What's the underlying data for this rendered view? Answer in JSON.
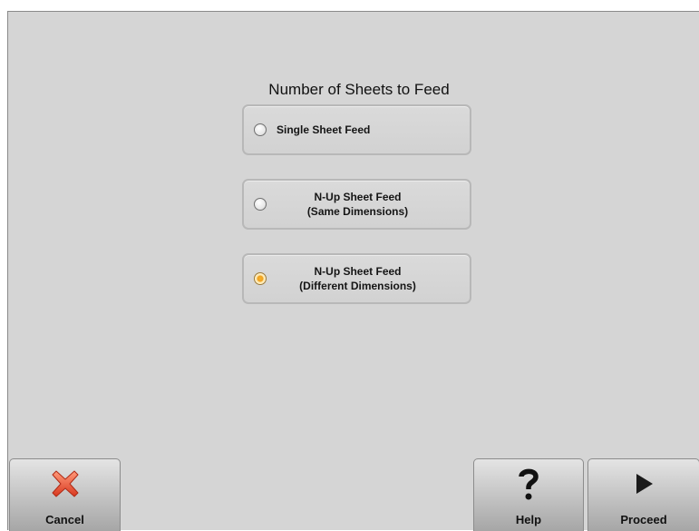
{
  "dialog": {
    "heading": "Number of Sheets to Feed",
    "options": [
      {
        "line1": "Single Sheet Feed",
        "line2": "",
        "selected": false
      },
      {
        "line1": "N-Up Sheet Feed",
        "line2": "(Same Dimensions)",
        "selected": false
      },
      {
        "line1": "N-Up Sheet Feed",
        "line2": "(Different Dimensions)",
        "selected": true
      }
    ]
  },
  "buttons": {
    "cancel": {
      "label": "Cancel",
      "icon": "x-icon",
      "color": "#e8513a"
    },
    "help": {
      "label": "Help",
      "icon": "question-mark-icon"
    },
    "proceed": {
      "label": "Proceed",
      "icon": "play-arrow-icon"
    }
  },
  "colors": {
    "selected_radio": "#f0a020",
    "panel_background": "#d5d5d5"
  }
}
